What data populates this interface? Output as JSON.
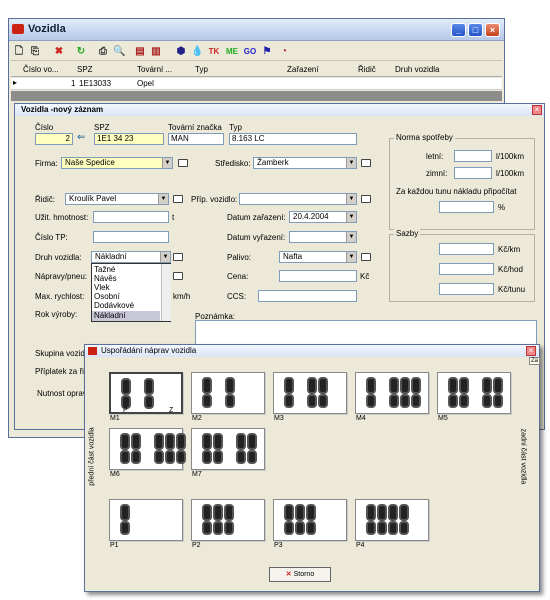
{
  "main_window": {
    "title": "Vozidla"
  },
  "grid": {
    "columns": [
      "Číslo vo...",
      "SPZ",
      "Tovární ...",
      "Typ",
      "Zařazení",
      "Řidič",
      "Druh vozidla"
    ],
    "row": {
      "cislo": "1",
      "spz": "1E13033",
      "tovarni": "Opel"
    }
  },
  "form": {
    "title": "Vozidla -nový záznam",
    "cislo_label": "Číslo",
    "cislo_value": "2",
    "spz_label": "SPZ",
    "spz_value": "1E1 34 23",
    "tovarni_label": "Tovární značka",
    "tovarni_value": "MAN",
    "typ_label": "Typ",
    "typ_value": "8.163 LC",
    "firma_label": "Firma:",
    "firma_value": "Naše Spedice",
    "stredisko_label": "Středisko:",
    "stredisko_value": "Žamberk",
    "ridic_label": "Řidič:",
    "ridic_value": "Kroulík Pavel",
    "pripojne_label": "Příp. vozidlo:",
    "uzit_label": "Užit. hmotnost:",
    "uzit_unit": "t",
    "datum_zarazeni_label": "Datum zařazení:",
    "datum_zarazeni_value": "20.4.2004",
    "cislo_tp_label": "Číslo TP:",
    "datum_vyrazeni_label": "Datum vyřazení:",
    "druh_label": "Druh vozidla:",
    "druh_value": "Nákladní",
    "palivo_label": "Palivo:",
    "palivo_value": "Nafta",
    "napravy_label": "Nápravy/pneu:",
    "cena_label": "Cena:",
    "cena_unit": "Kč",
    "max_label": "Max. rychlost:",
    "max_unit": "km/h",
    "ccs_label": "CCS:",
    "rok_label": "Rok výroby:",
    "poznamka_label": "Poznámka:",
    "skupina_label": "Skupina vozid",
    "priplatek_label": "Příplatek za ři",
    "nutnost_label": "Nutnost oprav",
    "dropdown_options": [
      "Tažné",
      "Návěs",
      "Vlek",
      "Osobní",
      "Dodávkové",
      "Nákladní"
    ],
    "norma": {
      "title": "Norma spotřeby",
      "letni": "letní:",
      "zimni": "zimní:",
      "unit": "l/100km",
      "kazdou": "Za každou tunu nákladu připočítat",
      "pct": "%"
    },
    "sazby": {
      "title": "Sazby",
      "km": "Kč/km",
      "hod": "Kč/hod",
      "tunu": "Kč/tunu"
    }
  },
  "axle_dialog": {
    "title": "Uspořádání náprav vozidla",
    "left_label": "přední část vozidla",
    "right_label": "zadní část vozidla",
    "storno": "Storno",
    "corner": "Za",
    "top_captions": [
      "M1",
      "M2",
      "M3",
      "M4",
      "M5",
      "M6",
      "M7"
    ],
    "bottom_captions": [
      "P1",
      "P2",
      "P3",
      "P4"
    ],
    "m1_p": "P",
    "m1_z": "Z"
  }
}
